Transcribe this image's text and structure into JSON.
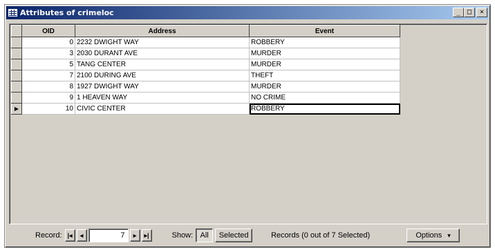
{
  "window": {
    "title": "Attributes of crimeloc"
  },
  "title_buttons": {
    "minimize": "_",
    "maximize": "□",
    "close": "×"
  },
  "table": {
    "columns": [
      "OID",
      "Address",
      "Event"
    ],
    "rows": [
      {
        "oid": "0",
        "address": "2232 DWIGHT WAY",
        "event": "ROBBERY"
      },
      {
        "oid": "3",
        "address": "2030 DURANT AVE",
        "event": "MURDER"
      },
      {
        "oid": "5",
        "address": "TANG CENTER",
        "event": "MURDER"
      },
      {
        "oid": "7",
        "address": "2100 DURING AVE",
        "event": "THEFT"
      },
      {
        "oid": "8",
        "address": "1927 DWIGHT WAY",
        "event": "MURDER"
      },
      {
        "oid": "9",
        "address": "1 HEAVEN WAY",
        "event": "NO CRIME"
      },
      {
        "oid": "10",
        "address": "CIVIC CENTER",
        "event": "ROBBERY"
      }
    ],
    "current_row_marker": "▶"
  },
  "statusbar": {
    "record_label": "Record:",
    "record_value": "7",
    "first_icon": "first-record-icon",
    "prev_icon": "previous-record-icon",
    "next_icon": "next-record-icon",
    "last_icon": "last-record-icon",
    "show_label": "Show:",
    "show_all": "All",
    "show_selected": "Selected",
    "records_summary": "Records (0 out of 7 Selected)",
    "options_label": "Options",
    "options_arrow": "▾"
  }
}
